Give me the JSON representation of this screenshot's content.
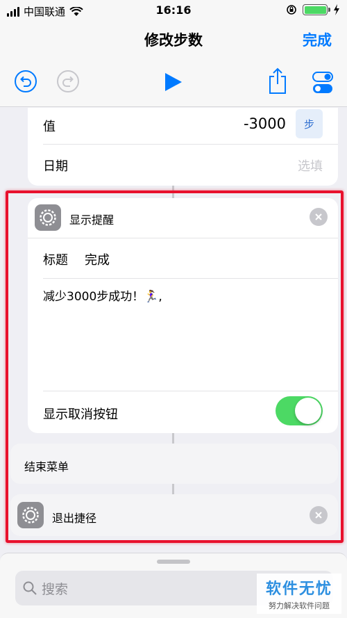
{
  "status_bar": {
    "carrier": "中国联通",
    "time": "16:16"
  },
  "nav": {
    "title": "修改步数",
    "done_label": "完成"
  },
  "toolbar": {
    "undo_icon": "undo-icon",
    "redo_icon": "redo-icon",
    "play_icon": "play-icon",
    "share_icon": "share-icon",
    "settings_icon": "toggles-icon"
  },
  "health_card": {
    "value_label": "值",
    "value": "-3000",
    "unit": "步",
    "date_label": "日期",
    "date_placeholder": "选填"
  },
  "alert_action": {
    "title": "显示提醒",
    "title_field_label": "标题",
    "title_field_value": "完成",
    "message": "减少3000步成功！🏃‍♀️,",
    "cancel_toggle_label": "显示取消按钮",
    "cancel_toggle_on": true
  },
  "end_menu": {
    "label": "结束菜单"
  },
  "exit_action": {
    "label": "退出捷径"
  },
  "search": {
    "placeholder": "搜索"
  },
  "watermark": {
    "title": "软件无忧",
    "subtitle": "努力解决软件问题"
  },
  "colors": {
    "accent": "#007aff",
    "toggle_on": "#4cd964",
    "highlight": "#e8112d"
  }
}
